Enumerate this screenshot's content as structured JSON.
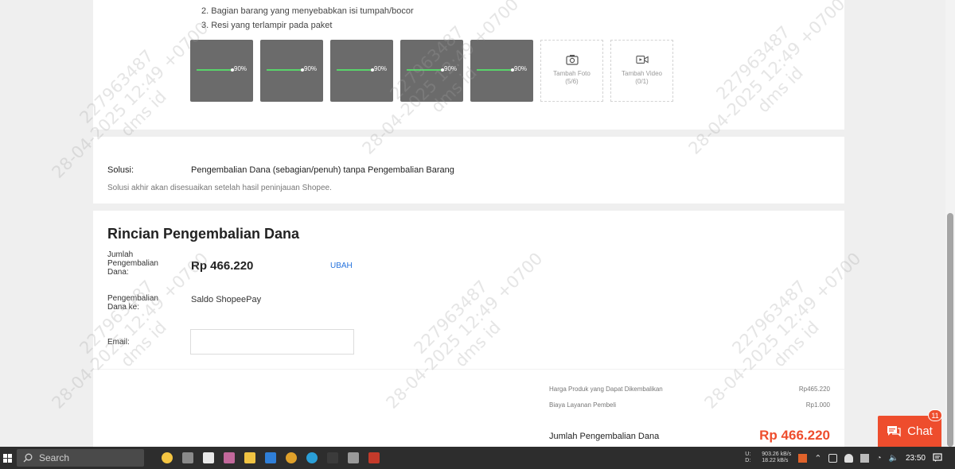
{
  "evidence": {
    "instructions": [
      "2. Bagian barang yang menyebabkan isi tumpah/bocor",
      "3. Resi yang terlampir pada paket"
    ],
    "thumbnails": [
      {
        "progress_label": "90%",
        "progress": 0.9
      },
      {
        "progress_label": "90%",
        "progress": 0.9
      },
      {
        "progress_label": "90%",
        "progress": 0.9
      },
      {
        "progress_label": "90%",
        "progress": 0.9
      },
      {
        "progress_label": "90%",
        "progress": 0.9
      }
    ],
    "add_photo": {
      "label": "Tambah Foto",
      "count": "(5/6)",
      "icon": "camera-icon"
    },
    "add_video": {
      "label": "Tambah Video",
      "count": "(0/1)",
      "icon": "video-camera-icon"
    }
  },
  "solution": {
    "label": "Solusi:",
    "value": "Pengembalian Dana (sebagian/penuh) tanpa Pengembalian Barang",
    "note": "Solusi akhir akan disesuaikan setelah hasil peninjauan Shopee."
  },
  "refund": {
    "title": "Rincian Pengembalian Dana",
    "amount_label": "Jumlah Pengembalian Dana:",
    "amount": "Rp 466.220",
    "change_label": "UBAH",
    "destination_label": "Pengembalian Dana ke:",
    "destination": "Saldo ShopeePay",
    "email_label": "Email:",
    "email_value": "",
    "summary": [
      {
        "label": "Harga Produk yang Dapat Dikembalikan",
        "value": "Rp465.220"
      },
      {
        "label": "Biaya Layanan Pembeli",
        "value": "Rp1.000"
      }
    ],
    "total_label": "Jumlah Pengembalian Dana",
    "total_value": "Rp 466.220"
  },
  "watermark": {
    "line1": "227963487",
    "line2": "28-04-2025 12:49 +0700",
    "line3": "dms id"
  },
  "chat": {
    "label": "Chat",
    "badge": "11"
  },
  "taskbar": {
    "search_placeholder": "Search",
    "net_up_label": "U:",
    "net_up": "903.26 kB/s",
    "net_down_label": "D:",
    "net_down": "18.22 kB/s",
    "time": "23:50"
  },
  "colors": {
    "accent": "#ee4d2d",
    "link": "#2673dd",
    "progress": "#58d46a"
  }
}
